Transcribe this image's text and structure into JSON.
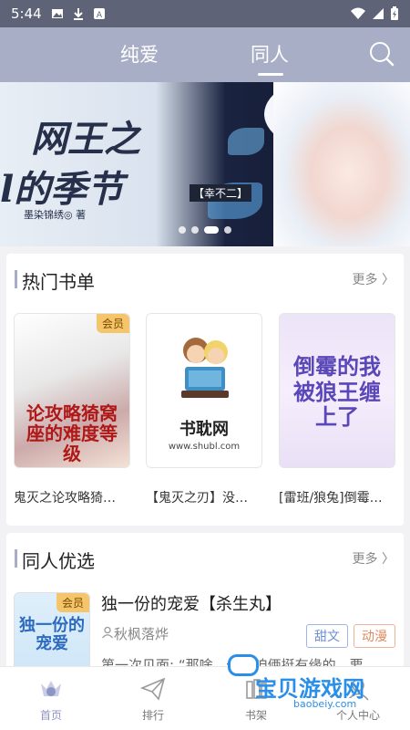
{
  "status_bar": {
    "time": "5:44"
  },
  "header": {
    "tabs": [
      {
        "label": "纯爱"
      },
      {
        "label": "同人"
      }
    ],
    "active_tab": "同人"
  },
  "banner": {
    "title_line1": "网王之",
    "title_line2": "l的季节",
    "tag": "【幸不二】",
    "author": "墨染锦绣◎ 著",
    "dots": 4
  },
  "hot_lists": {
    "title": "热门书单",
    "more": "更多 〉",
    "books": [
      {
        "title": "鬼灭之论攻略猗…",
        "badge": "会员",
        "cover_text": "论攻略猗窝座的难度等级"
      },
      {
        "title": "【鬼灭之刃】没…",
        "badge": "",
        "cover_name": "书耽网",
        "cover_url": "www.shubl.com"
      },
      {
        "title": "[雷班/狼兔]倒霉…",
        "badge": "",
        "cover_text": "倒霉的我被狼王缠上了"
      }
    ]
  },
  "featured": {
    "title": "同人优选",
    "more": "更多 〉",
    "item": {
      "badge": "会员",
      "cover_text": "独一份的宠爱",
      "title": "独一份的宠爱【杀生丸】",
      "author": "秋枫落烨",
      "tags": [
        "甜文",
        "动漫"
      ],
      "desc": "第一次见面: “那啥，你看咱俩挺有缘的，要"
    }
  },
  "bottom_nav": [
    {
      "label": "首页"
    },
    {
      "label": "排行"
    },
    {
      "label": "书架"
    },
    {
      "label": "个人中心"
    }
  ],
  "watermark": {
    "text": "宝贝游戏网",
    "url": "baobeiy.com"
  },
  "colors": {
    "header": "#a9aec7",
    "status": "#5f6378",
    "vip": "#f4c56b",
    "active_nav": "#8d95c7"
  }
}
